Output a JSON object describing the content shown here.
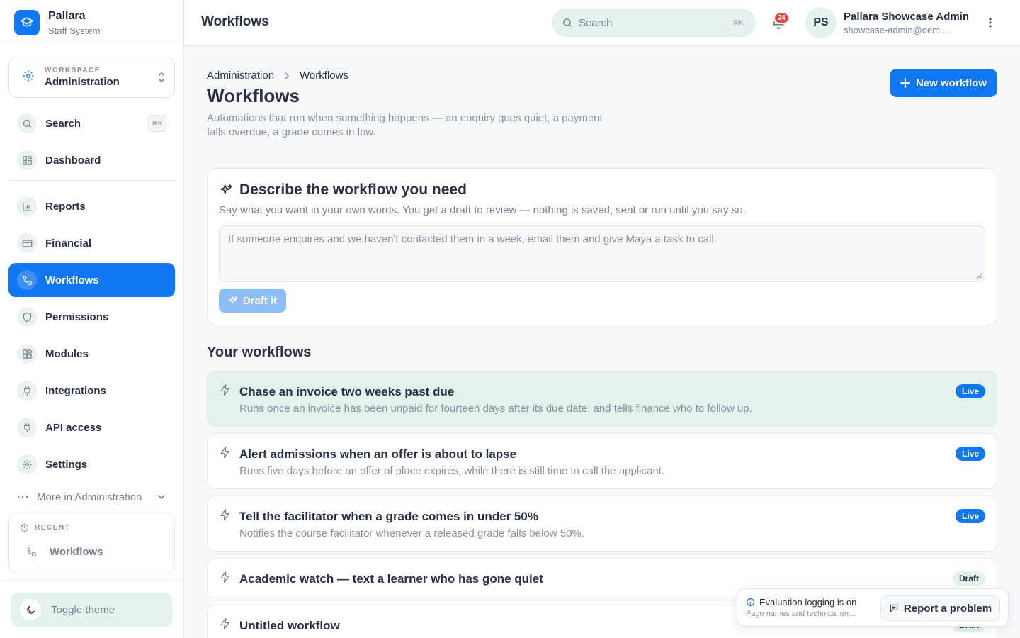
{
  "brand": {
    "name": "Pallara",
    "subtitle": "Staff System"
  },
  "workspace": {
    "label": "WORKSPACE",
    "value": "Administration"
  },
  "sidebar": {
    "search": {
      "label": "Search",
      "shortcut": "⌘K"
    },
    "items": [
      {
        "label": "Dashboard",
        "icon": "dashboard-icon"
      },
      {
        "label": "Reports",
        "icon": "bar-chart-icon"
      },
      {
        "label": "Financial",
        "icon": "credit-card-icon"
      },
      {
        "label": "Workflows",
        "icon": "workflow-icon",
        "active": true
      },
      {
        "label": "Permissions",
        "icon": "shield-icon"
      },
      {
        "label": "Modules",
        "icon": "modules-icon"
      },
      {
        "label": "Integrations",
        "icon": "plug-icon"
      },
      {
        "label": "API access",
        "icon": "plug-icon"
      },
      {
        "label": "Settings",
        "icon": "gear-icon"
      }
    ],
    "more": "More in Administration",
    "recent": {
      "label": "RECENT",
      "items": [
        "Workflows"
      ]
    },
    "toggle_theme": "Toggle theme"
  },
  "topbar": {
    "title": "Workflows",
    "search_placeholder": "Search",
    "search_shortcut": "⌘K",
    "notification_count": "24",
    "user": {
      "initials": "PS",
      "name": "Pallara Showcase Admin",
      "email": "showcase-admin@dem..."
    }
  },
  "page": {
    "breadcrumb": [
      "Administration",
      "Workflows"
    ],
    "title": "Workflows",
    "description": "Automations that run when something happens — an enquiry goes quiet, a payment falls overdue, a grade comes in low.",
    "new_button": "New workflow"
  },
  "describe": {
    "title": "Describe the workflow you need",
    "subtitle": "Say what you want in your own words. You get a draft to review — nothing is saved, sent or run until you say so.",
    "placeholder": "If someone enquires and we haven't contacted them in a week, email them and give Maya a task to call.",
    "button": "Draft it"
  },
  "workflows": {
    "section_title": "Your workflows",
    "items": [
      {
        "title": "Chase an invoice two weeks past due",
        "description": "Runs once an invoice has been unpaid for fourteen days after its due date, and tells finance who to follow up.",
        "status": "Live"
      },
      {
        "title": "Alert admissions when an offer is about to lapse",
        "description": "Runs five days before an offer of place expires, while there is still time to call the applicant.",
        "status": "Live"
      },
      {
        "title": "Tell the facilitator when a grade comes in under 50%",
        "description": "Notifies the course facilitator whenever a released grade falls below 50%.",
        "status": "Live"
      },
      {
        "title": "Academic watch — text a learner who has gone quiet",
        "description": "",
        "status": "Draft"
      },
      {
        "title": "Untitled workflow",
        "description": "",
        "status": "Draft"
      }
    ]
  },
  "toast": {
    "title": "Evaluation logging is on",
    "subtitle": "Page names and technical err...",
    "button": "Report a problem"
  },
  "colors": {
    "accent": "#1177f2",
    "mint": "#e3f2ec",
    "badge_red": "#ef4444"
  }
}
